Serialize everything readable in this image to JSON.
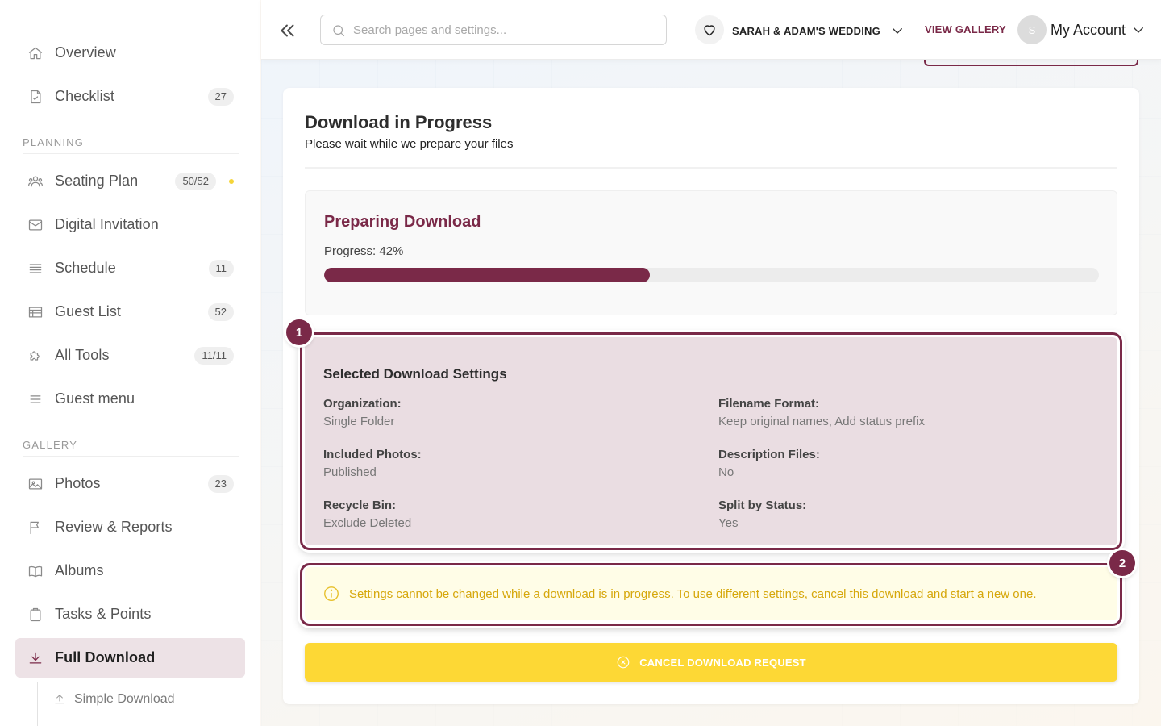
{
  "sidebar": {
    "items": [
      {
        "label": "Overview",
        "icon": "home-icon"
      },
      {
        "label": "Checklist",
        "icon": "checklist-icon",
        "badge": "27"
      },
      {
        "label": "Seating Plan",
        "icon": "people-icon",
        "badge": "50/52",
        "dot_color": "#f5d538"
      },
      {
        "label": "Digital Invitation",
        "icon": "envelope-icon"
      },
      {
        "label": "Schedule",
        "icon": "lines-icon",
        "badge": "11"
      },
      {
        "label": "Guest List",
        "icon": "table-icon",
        "badge": "52"
      },
      {
        "label": "All Tools",
        "icon": "puzzle-icon",
        "badge": "11/11"
      },
      {
        "label": "Guest menu",
        "icon": "menu-icon"
      },
      {
        "label": "Photos",
        "icon": "image-icon",
        "badge": "23"
      },
      {
        "label": "Review & Reports",
        "icon": "flag-icon"
      },
      {
        "label": "Albums",
        "icon": "book-icon"
      },
      {
        "label": "Tasks & Points",
        "icon": "clipboard-icon"
      },
      {
        "label": "Full Download",
        "icon": "download-icon",
        "active": true
      }
    ],
    "sections": {
      "planning": "PLANNING",
      "gallery": "GALLERY"
    },
    "sub_item": {
      "label": "Simple Download",
      "icon": "upload-icon"
    }
  },
  "header": {
    "search_placeholder": "Search pages and settings...",
    "event_name": "SARAH & ADAM'S WEDDING",
    "view_gallery": "VIEW GALLERY",
    "avatar_initial": "S",
    "account_label": "My Account"
  },
  "main": {
    "title": "Download in Progress",
    "subtitle": "Please wait while we prepare your files",
    "progress": {
      "title": "Preparing Download",
      "text": "Progress: 42%",
      "value_percent": 42
    },
    "settings": {
      "title": "Selected Download Settings",
      "items": [
        {
          "key": "Organization:",
          "value": "Single Folder"
        },
        {
          "key": "Filename Format:",
          "value": "Keep original names, Add status prefix"
        },
        {
          "key": "Included Photos:",
          "value": "Published"
        },
        {
          "key": "Description Files:",
          "value": "No"
        },
        {
          "key": "Recycle Bin:",
          "value": "Exclude Deleted"
        },
        {
          "key": "Split by Status:",
          "value": "Yes"
        }
      ]
    },
    "warning": "Settings cannot be changed while a download is in progress. To use different settings, cancel this download and start a new one.",
    "cancel_button": "CANCEL DOWNLOAD REQUEST"
  },
  "annotations": {
    "marker_1": "1",
    "marker_2": "2"
  },
  "colors": {
    "brand": "#7a2948",
    "accent_yellow": "#fdd835",
    "warning_text": "#d6a70b",
    "settings_bg": "#eadde2"
  }
}
